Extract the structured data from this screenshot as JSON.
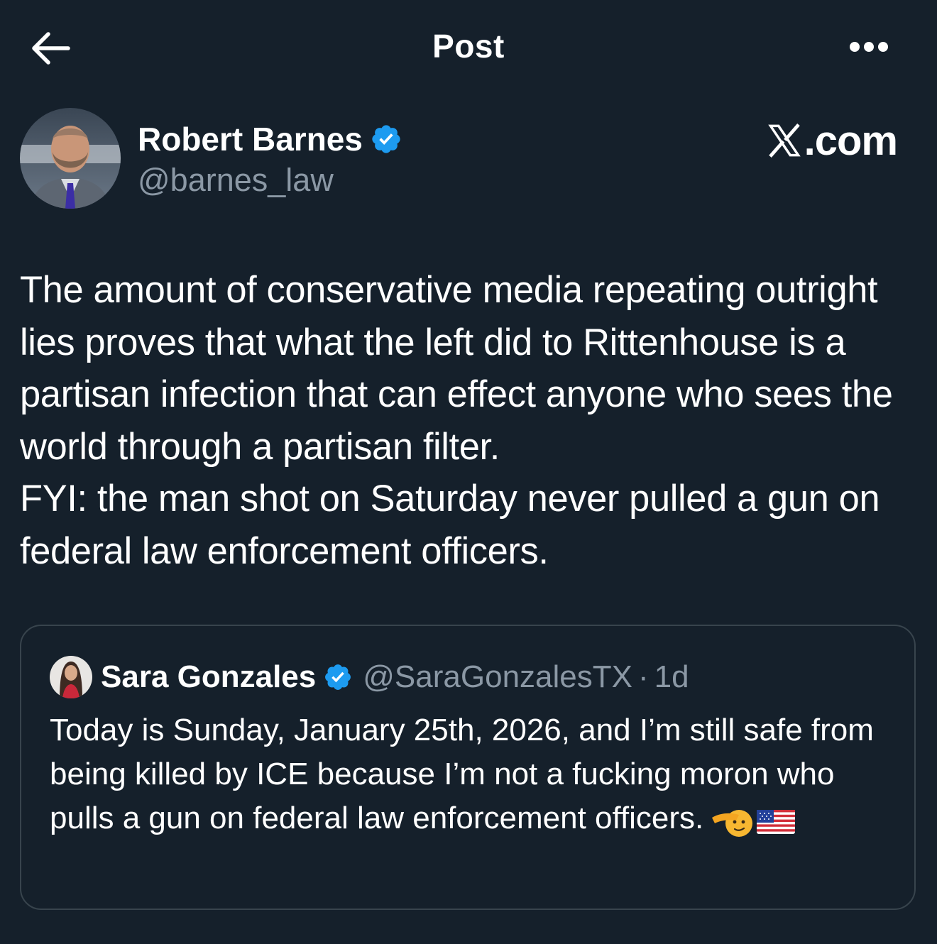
{
  "header": {
    "back_icon": "arrow-left-icon",
    "title": "Post",
    "more_icon": "more-horizontal-icon"
  },
  "post": {
    "author": {
      "name": "Robert Barnes",
      "handle": "@barnes_law",
      "verified": true
    },
    "brand": {
      "logo": "x-logo",
      "text": ".com"
    },
    "text": "The amount of conservative media repeating outright lies proves that what the left did to Rittenhouse is a partisan infection that can effect anyone who sees the world through a partisan filter.\nFYI: the man shot on Saturday never pulled a gun on federal law enforcement officers."
  },
  "quote": {
    "author": {
      "name": "Sara Gonzales",
      "handle": "@SaraGonzalesTX",
      "separator": "·",
      "time": "1d",
      "verified": true
    },
    "text": "Today is Sunday, January 25th, 2026, and I’m still safe from being killed by ICE because I’m not a fucking moron who pulls a gun on federal law enforcement officers.",
    "emojis": [
      "saluting-face-emoji",
      "us-flag-emoji"
    ]
  },
  "colors": {
    "background": "#15202b",
    "text": "#ffffff",
    "secondary_text": "#8b98a5",
    "verified_badge": "#1d9bf0",
    "card_border": "#38444d"
  }
}
